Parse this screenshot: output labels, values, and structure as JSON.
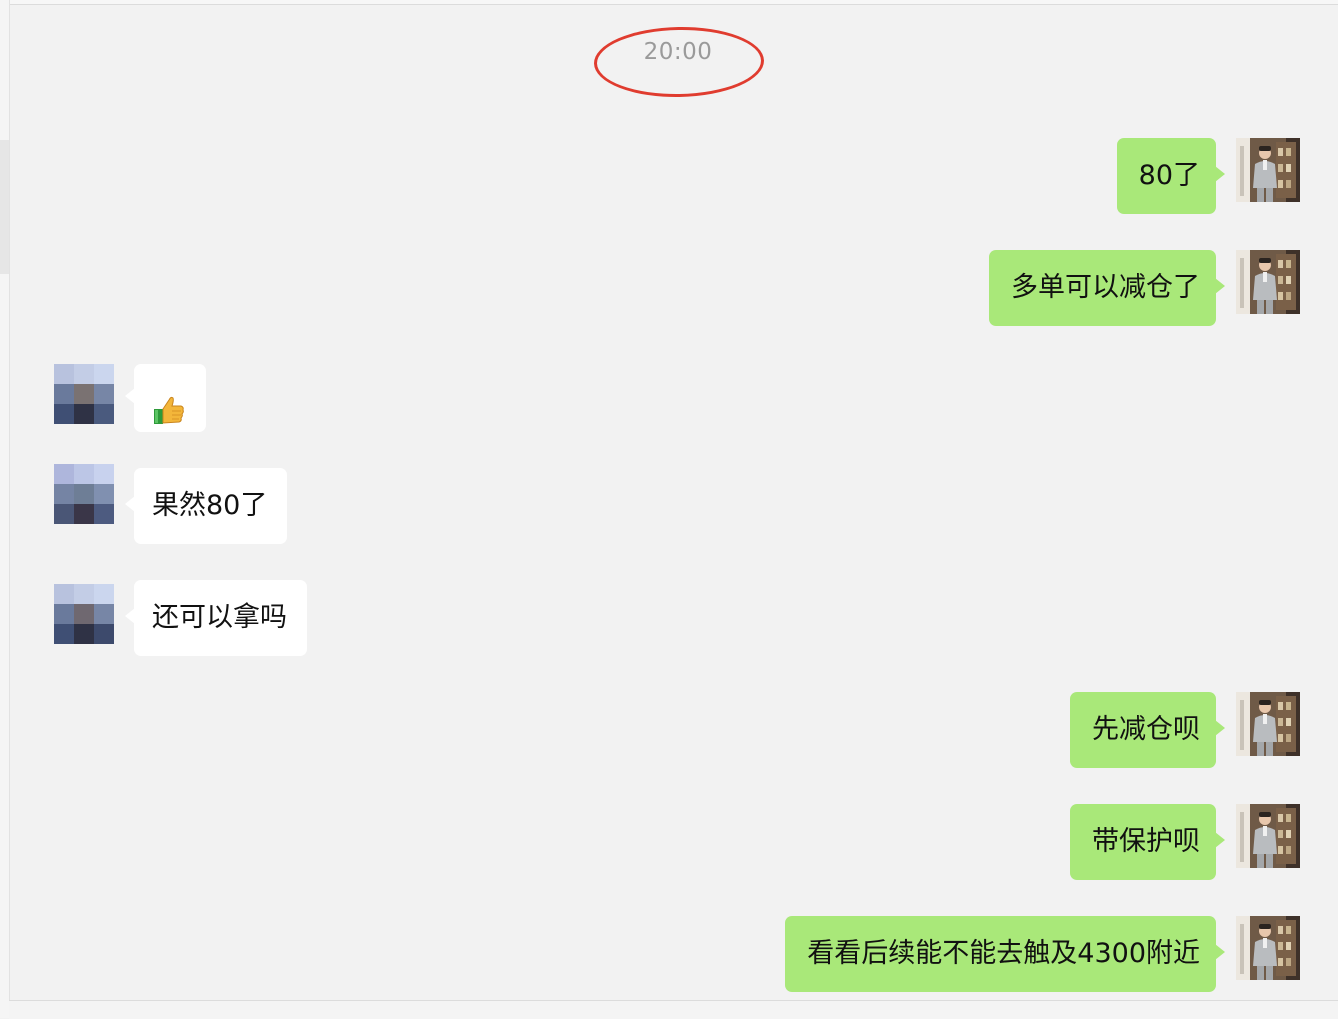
{
  "chat": {
    "timestamp": "20:00",
    "messages": [
      {
        "side": "out",
        "text": "80了"
      },
      {
        "side": "out",
        "text": "多单可以减仓了"
      },
      {
        "side": "in",
        "emoji": "thumbs-up"
      },
      {
        "side": "in",
        "text": "果然80了"
      },
      {
        "side": "in",
        "text": "还可以拿吗"
      },
      {
        "side": "out",
        "text": "先减仓呗"
      },
      {
        "side": "out",
        "text": "带保护呗"
      },
      {
        "side": "out",
        "text": "看看后续能不能去触及4300附近"
      }
    ]
  },
  "colors": {
    "outgoing_bubble": "#a9e879",
    "incoming_bubble": "#ffffff",
    "background": "#f2f2f2",
    "timestamp_highlight": "#e03c2f",
    "timestamp_text": "#9a9a9a"
  }
}
